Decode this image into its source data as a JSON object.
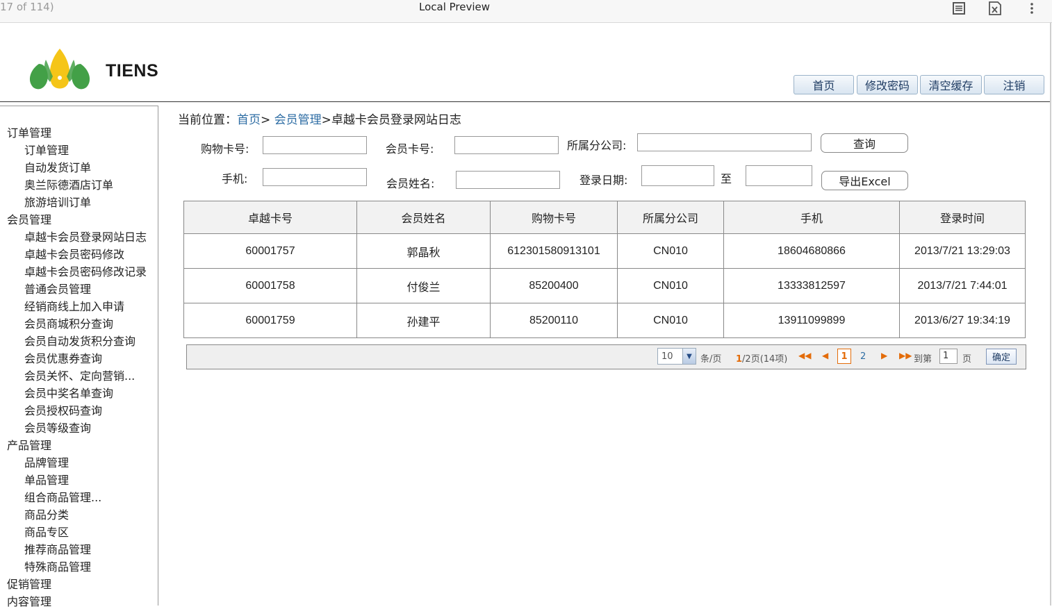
{
  "viewer": {
    "page_count": "17 of 114)",
    "title": "Local Preview",
    "icons": [
      "reader-icon",
      "excel-icon",
      "more-icon"
    ]
  },
  "brand": {
    "name": "TIENS",
    "logo_icon": "tiens-logo-icon"
  },
  "top_nav": [
    "首页",
    "修改密码",
    "清空缓存",
    "注销"
  ],
  "sidebar": [
    {
      "label": "订单管理",
      "level": 1
    },
    {
      "label": "订单管理",
      "level": 2
    },
    {
      "label": "自动发货订单",
      "level": 2
    },
    {
      "label": "奥兰际德酒店订单",
      "level": 2
    },
    {
      "label": "旅游培训订单",
      "level": 2
    },
    {
      "label": "会员管理",
      "level": 1
    },
    {
      "label": "卓越卡会员登录网站日志",
      "level": 2
    },
    {
      "label": "卓越卡会员密码修改",
      "level": 2
    },
    {
      "label": "卓越卡会员密码修改记录",
      "level": 2
    },
    {
      "label": "普通会员管理",
      "level": 2
    },
    {
      "label": "经销商线上加入申请",
      "level": 2
    },
    {
      "label": "会员商城积分查询",
      "level": 2
    },
    {
      "label": "会员自动发货积分查询",
      "level": 2
    },
    {
      "label": "会员优惠券查询",
      "level": 2
    },
    {
      "label": "会员关怀、定向营销...",
      "level": 2
    },
    {
      "label": "会员中奖名单查询",
      "level": 2
    },
    {
      "label": "会员授权码查询",
      "level": 2
    },
    {
      "label": "会员等级查询",
      "level": 2
    },
    {
      "label": "产品管理",
      "level": 1
    },
    {
      "label": "品牌管理",
      "level": 2
    },
    {
      "label": "单品管理",
      "level": 2
    },
    {
      "label": "组合商品管理...",
      "level": 2
    },
    {
      "label": "商品分类",
      "level": 2
    },
    {
      "label": "商品专区",
      "level": 2
    },
    {
      "label": "推荐商品管理",
      "level": 2
    },
    {
      "label": "特殊商品管理",
      "level": 2
    },
    {
      "label": "促销管理",
      "level": 1
    },
    {
      "label": "内容管理",
      "level": 1
    }
  ],
  "breadcrumb": {
    "prefix": "当前位置：",
    "home": "首页",
    "sep1": "> ",
    "section": "会员管理",
    "current": ">卓越卡会员登录网站日志"
  },
  "search": {
    "shopping_card_label": "购物卡号:",
    "member_card_label": "会员卡号:",
    "branch_label": "所属分公司:",
    "query_button": "查询",
    "phone_label": "手机:",
    "member_name_label": "会员姓名:",
    "login_date_label": "登录日期:",
    "date_to": "至",
    "export_button": "导出Excel"
  },
  "table": {
    "headers": [
      "卓越卡号",
      "会员姓名",
      "购物卡号",
      "所属分公司",
      "手机",
      "登录时间"
    ],
    "rows": [
      [
        "60001757",
        "郭晶秋",
        "612301580913101",
        "CN010",
        "18604680866",
        "2013/7/21 13:29:03"
      ],
      [
        "60001758",
        "付俊兰",
        "85200400",
        "CN010",
        "13333812597",
        "2013/7/21 7:44:01"
      ],
      [
        "60001759",
        "孙建平",
        "85200110",
        "CN010",
        "13911099899",
        "2013/6/27 19:34:19"
      ]
    ]
  },
  "pager": {
    "page_size": "10",
    "per_page": "条/页",
    "page_info_bold": "1",
    "page_info": "/2页(14项)",
    "current_page": "1",
    "next_page": "2",
    "goto_label": "到第",
    "goto_value": "1",
    "page_unit": "页",
    "confirm": "确定",
    "colors": {
      "accent": "#e36c0a",
      "link": "#2e6da4"
    }
  }
}
